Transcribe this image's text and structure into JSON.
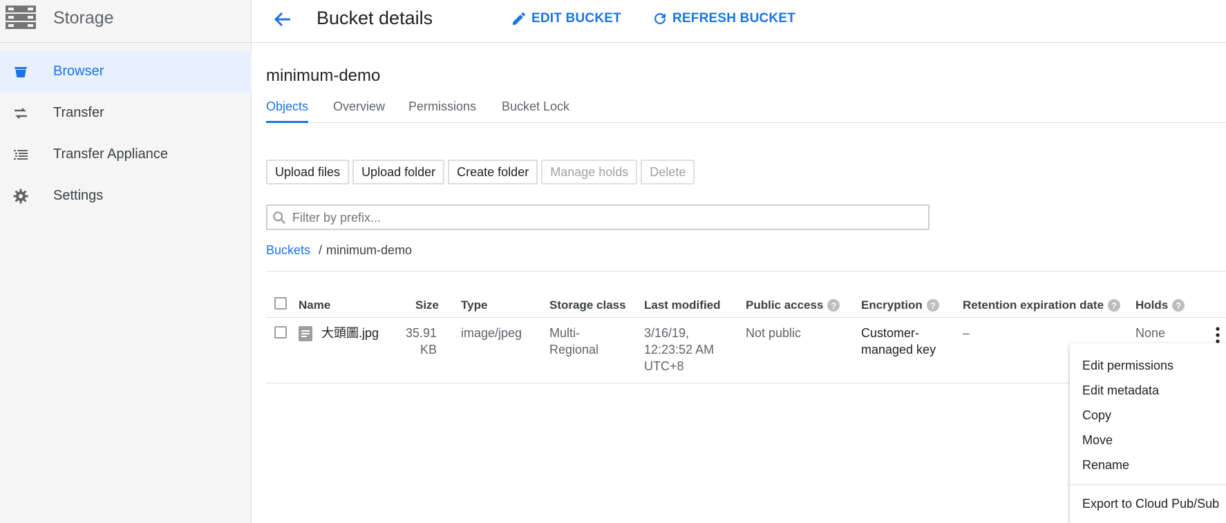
{
  "sidebar": {
    "title": "Storage",
    "items": [
      {
        "label": "Browser",
        "icon": "bucket-icon",
        "active": true
      },
      {
        "label": "Transfer",
        "icon": "transfer-arrows-icon"
      },
      {
        "label": "Transfer Appliance",
        "icon": "list-icon"
      },
      {
        "label": "Settings",
        "icon": "gear-icon"
      }
    ]
  },
  "header": {
    "title": "Bucket details",
    "edit_label": "EDIT BUCKET",
    "refresh_label": "REFRESH BUCKET"
  },
  "bucket": {
    "name": "minimum-demo"
  },
  "tabs": [
    {
      "label": "Objects",
      "active": true
    },
    {
      "label": "Overview"
    },
    {
      "label": "Permissions"
    },
    {
      "label": "Bucket Lock"
    }
  ],
  "actions": {
    "upload_files": "Upload files",
    "upload_folder": "Upload folder",
    "create_folder": "Create folder",
    "manage_holds": "Manage holds",
    "delete": "Delete"
  },
  "filter": {
    "placeholder": "Filter by prefix..."
  },
  "breadcrumb": {
    "root": "Buckets",
    "separator": "/",
    "current": "minimum-demo"
  },
  "table": {
    "headers": {
      "name": "Name",
      "size": "Size",
      "type": "Type",
      "storage_class": "Storage class",
      "last_modified": "Last modified",
      "public_access": "Public access",
      "encryption": "Encryption",
      "retention": "Retention expiration date",
      "holds": "Holds"
    },
    "rows": [
      {
        "name": "大頭圖.jpg",
        "size_line1": "35.91",
        "size_line2": "KB",
        "type": "image/jpeg",
        "storage_line1": "Multi-",
        "storage_line2": "Regional",
        "modified_line1": "3/16/19,",
        "modified_line2": "12:23:52 AM",
        "modified_line3": "UTC+8",
        "public_access": "Not public",
        "encryption_line1": "Customer-",
        "encryption_line2": "managed key",
        "retention": "–",
        "holds": "None"
      }
    ]
  },
  "context_menu": {
    "items": [
      "Edit permissions",
      "Edit metadata",
      "Copy",
      "Move",
      "Rename",
      "Export to Cloud Pub/Sub"
    ]
  },
  "colors": {
    "accent": "#1a73e8",
    "sidebar_bg": "#f5f5f5",
    "active_bg": "#e8f0fe"
  }
}
